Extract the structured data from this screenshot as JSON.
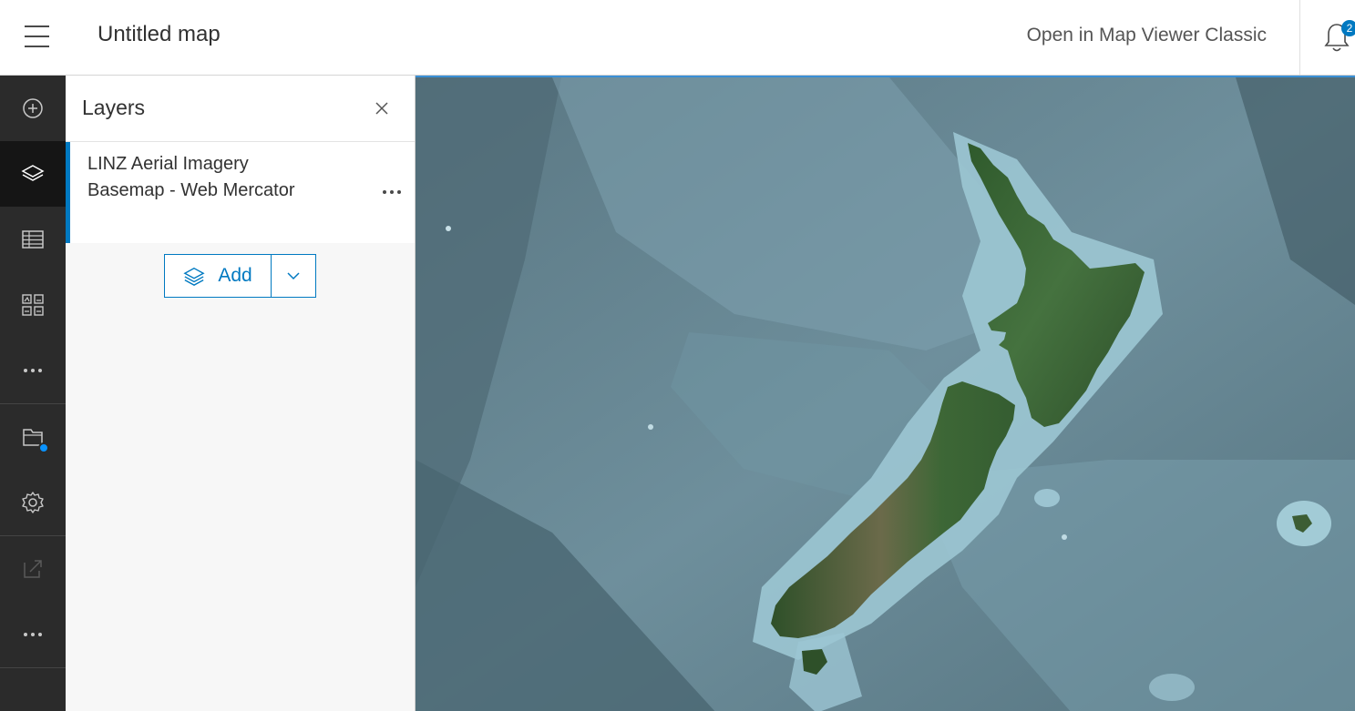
{
  "header": {
    "title": "Untitled map",
    "open_classic_label": "Open in Map Viewer Classic",
    "notification_count": "2"
  },
  "action_bar": {
    "items": [
      {
        "icon": "add-circle-icon",
        "name": "add"
      },
      {
        "icon": "layers-icon",
        "name": "layers",
        "active": true
      },
      {
        "icon": "table-icon",
        "name": "tables"
      },
      {
        "icon": "legend-icon",
        "name": "legend"
      },
      {
        "icon": "more-icon",
        "name": "more-top"
      },
      {
        "icon": "folder-icon",
        "name": "save-open",
        "badge": true
      },
      {
        "icon": "gear-icon",
        "name": "settings"
      },
      {
        "icon": "share-icon",
        "name": "share",
        "disabled": true
      },
      {
        "icon": "more-icon",
        "name": "more-bottom"
      }
    ]
  },
  "layers_panel": {
    "title": "Layers",
    "layers": [
      {
        "name": "LINZ Aerial Imagery Basemap - Web Mercator"
      }
    ],
    "add_label": "Add"
  },
  "colors": {
    "accent": "#0079c1",
    "action_bar_bg": "#2b2b2b",
    "active_action_bg": "#151515",
    "ocean_deep": "#4d6773",
    "ocean_shallow": "#8fb7c6",
    "land": "#3e6a3a"
  }
}
